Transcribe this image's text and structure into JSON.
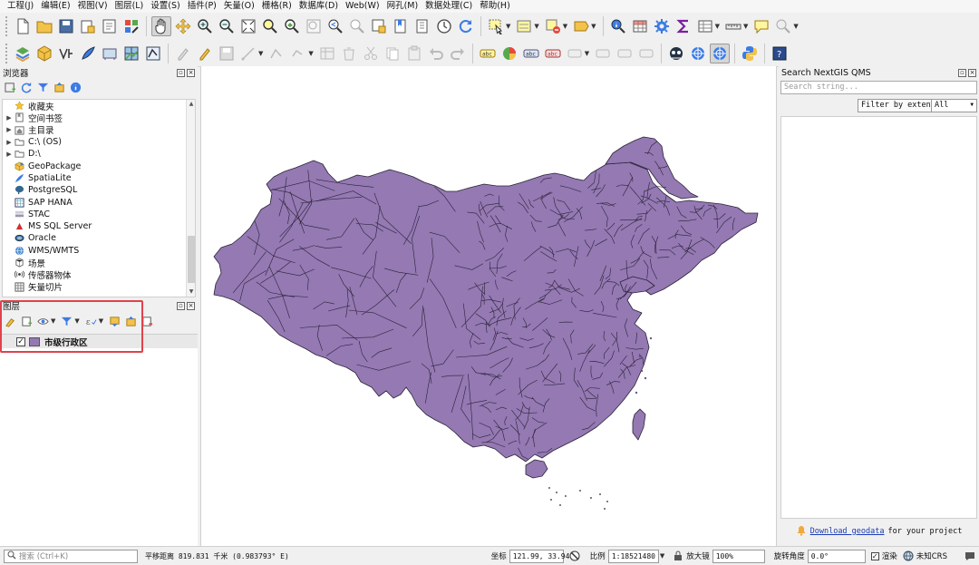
{
  "menu": [
    "工程(J)",
    "编辑(E)",
    "视图(V)",
    "图层(L)",
    "设置(S)",
    "插件(P)",
    "矢量(O)",
    "栅格(R)",
    "数据库(D)",
    "Web(W)",
    "网孔(M)",
    "数据处理(C)",
    "帮助(H)"
  ],
  "browser": {
    "title": "浏览器",
    "items": [
      {
        "label": "收藏夹",
        "icon": "star-icon",
        "expandable": false
      },
      {
        "label": "空间书签",
        "icon": "bookmark-icon",
        "expandable": true
      },
      {
        "label": "主目录",
        "icon": "home-folder-icon",
        "expandable": true
      },
      {
        "label": "C:\\ (OS)",
        "icon": "folder-icon",
        "expandable": true
      },
      {
        "label": "D:\\",
        "icon": "folder-icon",
        "expandable": true
      },
      {
        "label": "GeoPackage",
        "icon": "geopackage-icon",
        "expandable": false
      },
      {
        "label": "SpatiaLite",
        "icon": "spatialite-icon",
        "expandable": false
      },
      {
        "label": "PostgreSQL",
        "icon": "postgresql-icon",
        "expandable": false
      },
      {
        "label": "SAP HANA",
        "icon": "sap-hana-icon",
        "expandable": false
      },
      {
        "label": "STAC",
        "icon": "stac-icon",
        "expandable": false
      },
      {
        "label": "MS SQL Server",
        "icon": "mssql-icon",
        "expandable": false
      },
      {
        "label": "Oracle",
        "icon": "oracle-icon",
        "expandable": false
      },
      {
        "label": "WMS/WMTS",
        "icon": "wms-icon",
        "expandable": false
      },
      {
        "label": "场景",
        "icon": "scene-icon",
        "expandable": false
      },
      {
        "label": "传感器物体",
        "icon": "sensor-icon",
        "expandable": false
      },
      {
        "label": "矢量切片",
        "icon": "vector-tile-icon",
        "expandable": false
      }
    ]
  },
  "layers": {
    "title": "图层",
    "items": [
      {
        "name": "市级行政区",
        "checked": true,
        "color": "#9479b3"
      }
    ]
  },
  "qms": {
    "title": "Search NextGIS QMS",
    "search_placeholder": "Search string...",
    "filter_label": "Filter by extent",
    "select_value": "All",
    "footer_link": "Download geodata",
    "footer_text": "for your project"
  },
  "status": {
    "locator_placeholder": "搜索 (Ctrl+K)",
    "message": "平移距离 819.831 千米 (0.983793° E)",
    "coord_label": "坐标",
    "coord_value": "121.99, 33.94",
    "scale_label": "比例",
    "scale_value": "1:18521480",
    "magnifier_label": "放大镜",
    "magnifier_value": "100%",
    "rotation_label": "旋转角度",
    "rotation_value": "0.0°",
    "render_label": "渲染",
    "crs_label": "未知CRS"
  },
  "colors": {
    "polygon_fill": "#9479b3",
    "polygon_stroke": "#2a2236",
    "highlight": "#e0424d"
  }
}
